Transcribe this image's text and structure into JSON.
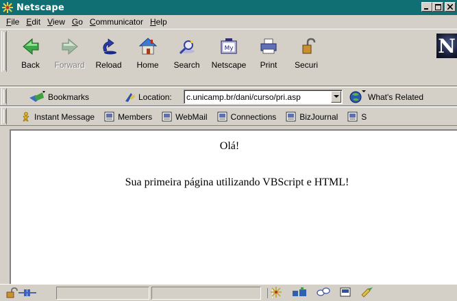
{
  "window": {
    "title": "Netscape",
    "title_bar_color": "#0f6f73",
    "controls": [
      "minimize-icon",
      "maximize-icon",
      "close-icon"
    ]
  },
  "menubar": {
    "items": [
      {
        "label": "File",
        "accel": "F"
      },
      {
        "label": "Edit",
        "accel": "E"
      },
      {
        "label": "View",
        "accel": "V"
      },
      {
        "label": "Go",
        "accel": "G"
      },
      {
        "label": "Communicator",
        "accel": "C"
      },
      {
        "label": "Help",
        "accel": "H"
      }
    ]
  },
  "toolbar": {
    "buttons": [
      {
        "label": "Back",
        "icon": "back-arrow-icon",
        "enabled": true
      },
      {
        "label": "Forward",
        "icon": "forward-arrow-icon",
        "enabled": false
      },
      {
        "label": "Reload",
        "icon": "reload-icon",
        "enabled": true
      },
      {
        "label": "Home",
        "icon": "home-icon",
        "enabled": true
      },
      {
        "label": "Search",
        "icon": "search-icon",
        "enabled": true
      },
      {
        "label": "Netscape",
        "icon": "netscape-icon",
        "enabled": true
      },
      {
        "label": "Print",
        "icon": "print-icon",
        "enabled": true
      },
      {
        "label": "Securi",
        "icon": "security-lock-icon",
        "enabled": true
      }
    ],
    "logo_letter": "N"
  },
  "location_bar": {
    "bookmarks_label": "Bookmarks",
    "location_label": "Location:",
    "url": "c.unicamp.br/dani/curso/pri.asp",
    "related_label": "What's Related"
  },
  "personal_toolbar": {
    "items": [
      {
        "label": "Instant Message",
        "icon": "instant-message-icon"
      },
      {
        "label": "Members",
        "icon": "bookmark-page-icon"
      },
      {
        "label": "WebMail",
        "icon": "bookmark-page-icon"
      },
      {
        "label": "Connections",
        "icon": "bookmark-page-icon"
      },
      {
        "label": "BizJournal",
        "icon": "bookmark-page-icon"
      },
      {
        "label": "S",
        "icon": "bookmark-page-icon"
      }
    ]
  },
  "page": {
    "greeting": "Olá!",
    "message": "Sua primeira página utilizando VBScript e HTML!"
  },
  "statusbar": {
    "status_text": "",
    "icons": [
      "security-icon",
      "connection-icon",
      "navigator-icon",
      "mailbox-icon",
      "discussion-icon",
      "composer-icon",
      "dial-icon"
    ]
  }
}
